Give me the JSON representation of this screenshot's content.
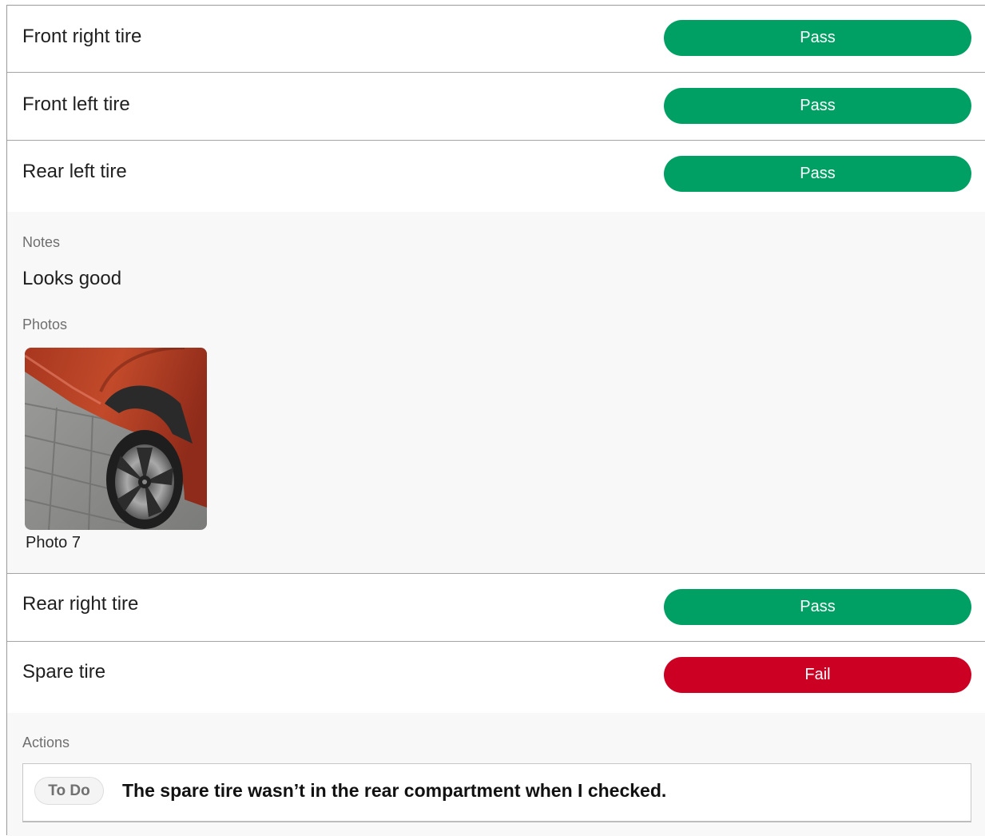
{
  "rows": [
    {
      "label": "Front right tire",
      "status": "Pass"
    },
    {
      "label": "Front left tire",
      "status": "Pass"
    },
    {
      "label": "Rear left tire",
      "status": "Pass"
    },
    {
      "label": "Rear right tire",
      "status": "Pass"
    },
    {
      "label": "Spare tire",
      "status": "Fail"
    }
  ],
  "rear_left_detail": {
    "notes_label": "Notes",
    "notes_text": "Looks good",
    "photos_label": "Photos",
    "photo_caption": "Photo 7"
  },
  "spare_detail": {
    "actions_label": "Actions",
    "action_badge": "To Do",
    "action_text": "The spare tire wasn’t in the rear compartment when I checked."
  },
  "colors": {
    "pass": "#00a064",
    "fail": "#cc0022"
  }
}
